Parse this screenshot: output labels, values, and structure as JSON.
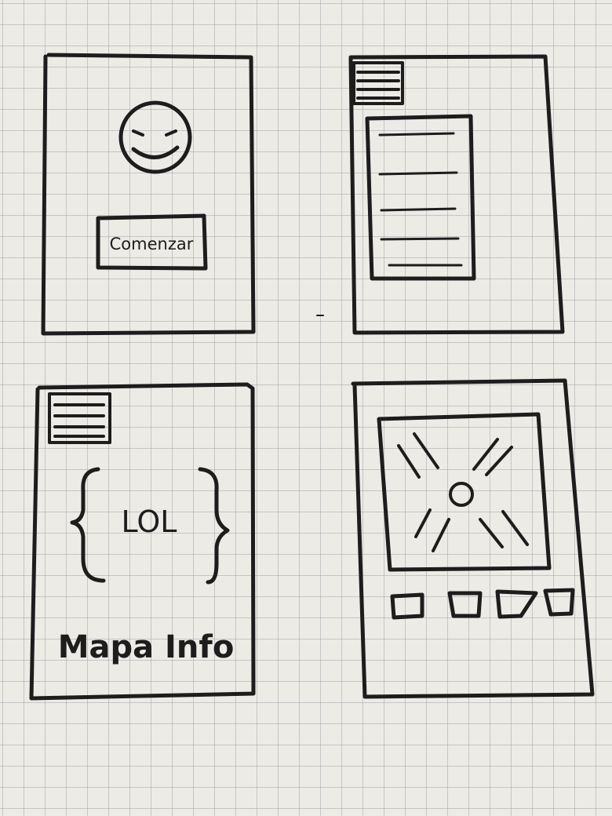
{
  "screen1": {
    "button_label": "Comenzar"
  },
  "screen3": {
    "center_text": "LOL",
    "footer_text": "Mapa Info"
  },
  "colors": {
    "ink": "#1e1c1c",
    "paper": "#ecebe6",
    "grid": "#9696a0"
  }
}
